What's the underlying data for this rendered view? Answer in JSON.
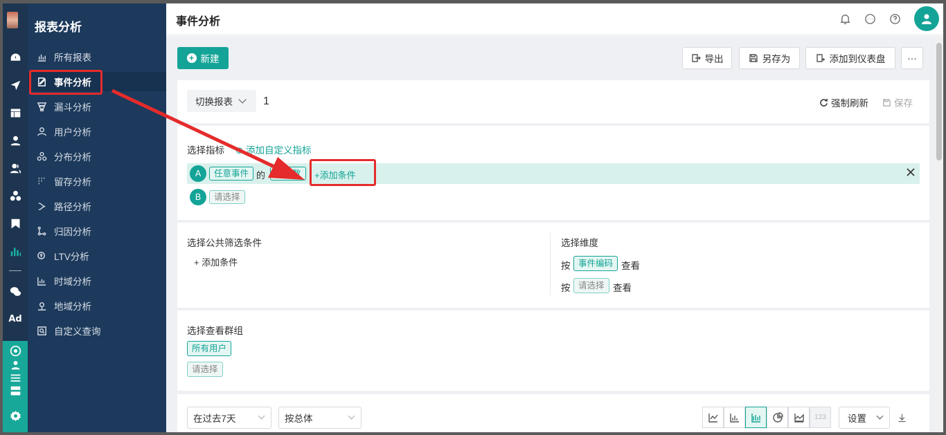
{
  "sidebar": {
    "title": "报表分析",
    "items": [
      {
        "label": "所有报表",
        "icon": "bar-chart-icon"
      },
      {
        "label": "事件分析",
        "icon": "edit-doc-icon",
        "active": true
      },
      {
        "label": "漏斗分析",
        "icon": "funnel-icon"
      },
      {
        "label": "用户分析",
        "icon": "user-icon"
      },
      {
        "label": "分布分析",
        "icon": "distribution-icon"
      },
      {
        "label": "留存分析",
        "icon": "dots-grid-icon"
      },
      {
        "label": "路径分析",
        "icon": "path-icon"
      },
      {
        "label": "归因分析",
        "icon": "attribution-icon"
      },
      {
        "label": "LTV分析",
        "icon": "ltv-icon"
      },
      {
        "label": "时域分析",
        "icon": "time-chart-icon"
      },
      {
        "label": "地域分析",
        "icon": "map-pin-icon"
      },
      {
        "label": "自定义查询",
        "icon": "query-icon"
      }
    ]
  },
  "rail": {
    "ad_label": "Ad"
  },
  "header": {
    "title": "事件分析"
  },
  "toolbar": {
    "new_label": "新建",
    "export_label": "导出",
    "save_as_label": "另存为",
    "add_dashboard_label": "添加到仪表盘",
    "more_label": "···"
  },
  "report_bar": {
    "switch_label": "切换报表",
    "report_number": "1",
    "refresh_label": "强制刷新",
    "save_label": "保存"
  },
  "metrics": {
    "section_label": "选择指标",
    "add_custom_label": "添加自定义指标",
    "rows": [
      {
        "letter": "A",
        "event": "任意事件",
        "of": "的",
        "measure": "总次数",
        "add_condition": "+添加条件"
      },
      {
        "letter": "B",
        "placeholder": "请选择"
      }
    ]
  },
  "filters": {
    "section_label": "选择公共筛选条件",
    "add_condition": "+ 添加条件"
  },
  "dimensions": {
    "section_label": "选择维度",
    "rows": [
      {
        "by": "按",
        "value": "事件编码",
        "view": "查看"
      },
      {
        "by": "按",
        "value": "请选择",
        "view": "查看"
      }
    ]
  },
  "groups": {
    "section_label": "选择查看群组",
    "items": [
      "所有用户",
      "请选择"
    ]
  },
  "query_bar": {
    "time_range": "在过去7天",
    "granularity": "按总体",
    "chart_disabled_label": "123",
    "settings_label": "设置"
  },
  "colors": {
    "accent": "#14a497",
    "sidebar": "#1d3a5c",
    "highlight": "#e52b2b"
  }
}
